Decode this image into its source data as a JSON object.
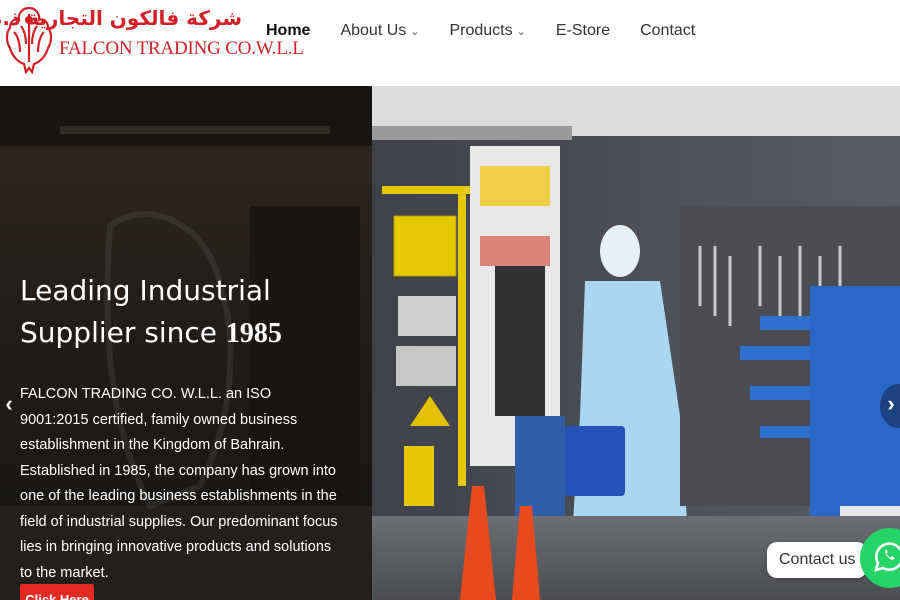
{
  "brand": {
    "arabic_name": "شركة فالكون التجارية ذ.م.م",
    "english_name": "FALCON TRADING CO.W.L.L",
    "logo_icon": "falcon-emblem-icon",
    "color": "#d21f26"
  },
  "nav": {
    "items": [
      {
        "label": "Home",
        "active": true,
        "has_dropdown": false
      },
      {
        "label": "About Us",
        "active": false,
        "has_dropdown": true
      },
      {
        "label": "Products",
        "active": false,
        "has_dropdown": true
      },
      {
        "label": "E-Store",
        "active": false,
        "has_dropdown": false
      },
      {
        "label": "Contact",
        "active": false,
        "has_dropdown": false
      }
    ],
    "dropdown_icon": "chevron-down-icon"
  },
  "hero": {
    "title_line1": "Leading Industrial",
    "title_line2_prefix": "Supplier since ",
    "title_year": "1985",
    "description": "FALCON TRADING CO. W.L.L. an ISO 9001:2015 certified, family owned business establishment in the Kingdom of Bahrain. Established in 1985, the company has grown into one of the leading business establishments in the field of industrial supplies. Our predominant focus lies in bringing innovative products and solutions to the market.",
    "cta_label": "Click Here",
    "prev_icon": "chevron-left-icon",
    "next_icon": "chevron-right-icon",
    "prev_glyph": "‹",
    "next_glyph": "›",
    "cta_color": "#e32b24"
  },
  "chat": {
    "label": "Contact us",
    "icon": "whatsapp-icon",
    "color": "#25d366"
  }
}
